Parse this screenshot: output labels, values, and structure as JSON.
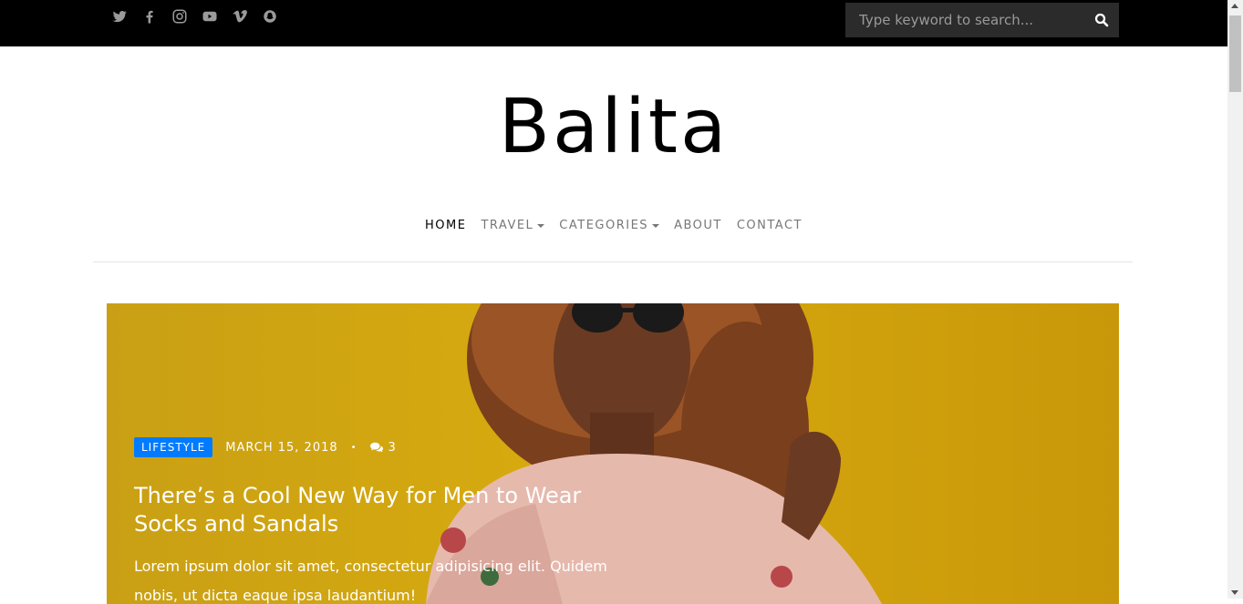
{
  "social": {
    "icons": [
      "twitter-icon",
      "facebook-icon",
      "instagram-icon",
      "youtube-icon",
      "vimeo-icon",
      "snapchat-icon"
    ]
  },
  "search": {
    "placeholder": "Type keyword to search..."
  },
  "site": {
    "title": "Balita"
  },
  "nav": {
    "items": [
      {
        "label": "HOME"
      },
      {
        "label": "TRAVEL"
      },
      {
        "label": "CATEGORIES"
      },
      {
        "label": "ABOUT"
      },
      {
        "label": "CONTACT"
      }
    ]
  },
  "hero": {
    "category": "LIFESTYLE",
    "date": "MARCH 15, 2018",
    "separator": "•",
    "comment_count": "3",
    "title": "There’s a Cool New Way for Men to Wear Socks and Sandals",
    "excerpt": "Lorem ipsum dolor sit amet, consectetur adipisicing elit. Quidem nobis, ut dicta eaque ipsa laudantium!"
  },
  "colors": {
    "badge": "#007bff",
    "topbar": "#000000",
    "hero_bg": "#d4a40f"
  }
}
